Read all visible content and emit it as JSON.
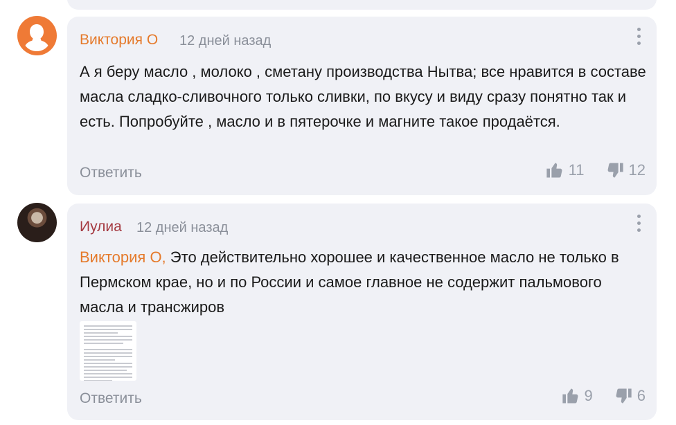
{
  "comments": [
    {
      "author": "Виктория О",
      "time": "12 дней назад",
      "text": "А я беру масло , молоко , сметану производства Нытва; все нравится в составе масла сладко-сливочного только сливки, по вкусу и виду сразу понятно так и есть. Попробуйте , масло и в пятерочке и магните такое продаётся.",
      "reply_label": "Ответить",
      "likes": "11",
      "dislikes": "12"
    },
    {
      "author": "Иулиа",
      "time": "12 дней назад",
      "mention": "Виктория О,",
      "text": " Это действительно хорошее и качественное масло не только в Пермском крае, но и по России и самое главное не содержит пальмового масла и трансжиров",
      "reply_label": "Ответить",
      "likes": "9",
      "dislikes": "6"
    }
  ],
  "icons": {
    "like": "thumbs-up-icon",
    "dislike": "thumbs-down-icon",
    "menu": "kebab-menu-icon"
  },
  "colors": {
    "card_bg": "#f0f1f6",
    "author_orange": "#e57a2b",
    "author_red": "#a53a41",
    "muted": "#8a8f99"
  }
}
